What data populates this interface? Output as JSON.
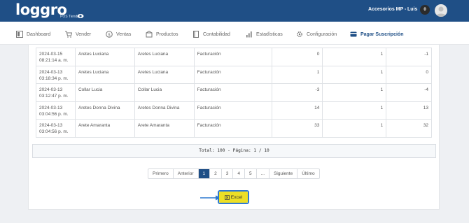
{
  "header": {
    "logo_text": "loggro",
    "logo_sub": "POS Tienda",
    "company": "Accesorios MP -",
    "user": "Luis",
    "notifications": "0"
  },
  "nav": [
    {
      "label": "Dashboard",
      "icon": "dashboard-icon"
    },
    {
      "label": "Vender",
      "icon": "cart-icon"
    },
    {
      "label": "Ventas",
      "icon": "money-icon"
    },
    {
      "label": "Productos",
      "icon": "products-icon"
    },
    {
      "label": "Contabilidad",
      "icon": "book-icon"
    },
    {
      "label": "Estadísticas",
      "icon": "stats-icon"
    },
    {
      "label": "Configuración",
      "icon": "settings-icon"
    },
    {
      "label": "Pagar Suscripción",
      "icon": "card-icon",
      "active": true
    }
  ],
  "table": {
    "rows": [
      {
        "date": "2024-03-15",
        "time": "08:21:14 a. m.",
        "product": "Aretes Luciana",
        "variant": "Aretes Luciana",
        "type": "Facturación",
        "qty": "0",
        "units": "1",
        "diff": "-1"
      },
      {
        "date": "2024-03-13",
        "time": "03:18:34 p. m.",
        "product": "Aretes Luciana",
        "variant": "Aretes Luciana",
        "type": "Facturación",
        "qty": "1",
        "units": "1",
        "diff": "0"
      },
      {
        "date": "2024-03-13",
        "time": "03:12:47 p. m.",
        "product": "Collar Lucia",
        "variant": "Collar Lucia",
        "type": "Facturación",
        "qty": "-3",
        "units": "1",
        "diff": "-4"
      },
      {
        "date": "2024-03-13",
        "time": "03:04:56 p. m.",
        "product": "Aretes Donna Divina",
        "variant": "Aretes Donna Divina",
        "type": "Facturación",
        "qty": "14",
        "units": "1",
        "diff": "13"
      },
      {
        "date": "2024-03-13",
        "time": "03:04:56 p. m.",
        "product": "Arete Amaranta",
        "variant": "Arete Amaranta",
        "type": "Facturación",
        "qty": "33",
        "units": "1",
        "diff": "32"
      }
    ]
  },
  "summary": "Total: 100 - Página: 1 / 10",
  "pagination": [
    "Primero",
    "Anterior",
    "1",
    "2",
    "3",
    "4",
    "5",
    "...",
    "Siguiente",
    "Último"
  ],
  "pagination_active": "1",
  "excel_label": "Excel",
  "colors": {
    "brand": "#1f4f86",
    "excel": "#ecdf26",
    "highlight": "#2f7ad1"
  }
}
